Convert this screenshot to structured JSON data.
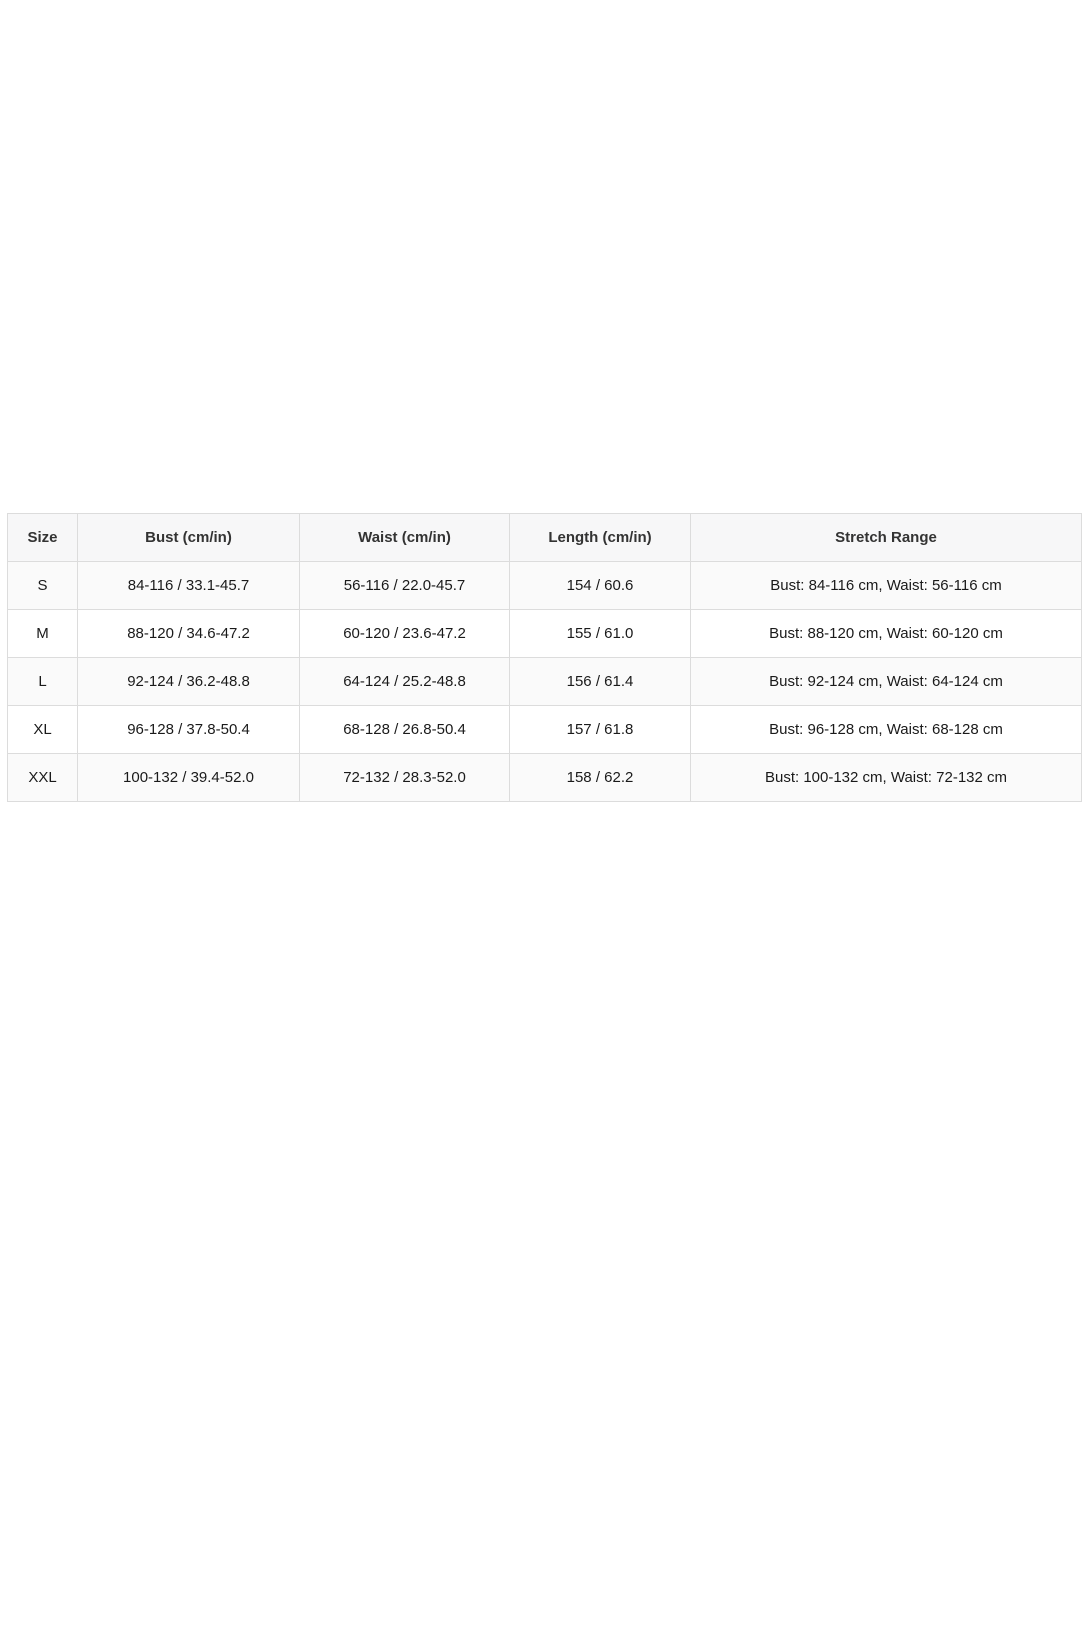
{
  "table": {
    "headers": [
      "Size",
      "Bust (cm/in)",
      "Waist (cm/in)",
      "Length (cm/in)",
      "Stretch Range"
    ],
    "rows": [
      [
        "S",
        "84-116 / 33.1-45.7",
        "56-116 / 22.0-45.7",
        "154 / 60.6",
        "Bust: 84-116 cm, Waist: 56-116 cm"
      ],
      [
        "M",
        "88-120 / 34.6-47.2",
        "60-120 / 23.6-47.2",
        "155 / 61.0",
        "Bust: 88-120 cm, Waist: 60-120 cm"
      ],
      [
        "L",
        "92-124 / 36.2-48.8",
        "64-124 / 25.2-48.8",
        "156 / 61.4",
        "Bust: 92-124 cm, Waist: 64-124 cm"
      ],
      [
        "XL",
        "96-128 / 37.8-50.4",
        "68-128 / 26.8-50.4",
        "157 / 61.8",
        "Bust: 96-128 cm, Waist: 68-128 cm"
      ],
      [
        "XXL",
        "100-132 / 39.4-52.0",
        "72-132 / 28.3-52.0",
        "158 / 62.2",
        "Bust: 100-132 cm, Waist: 72-132 cm"
      ]
    ]
  }
}
